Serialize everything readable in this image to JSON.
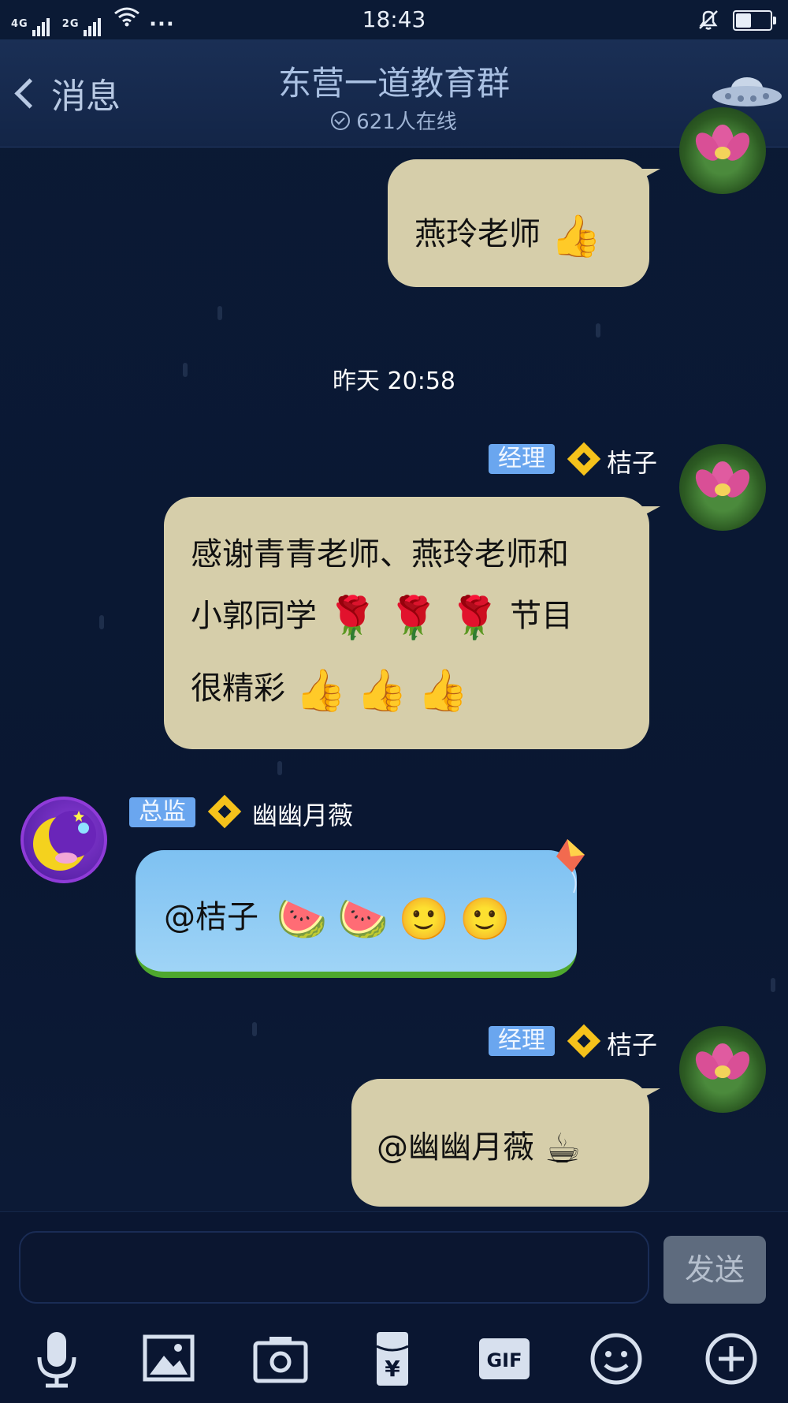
{
  "status_bar": {
    "network_1": "4G",
    "network_2": "2G",
    "time": "18:43",
    "battery_level": 0.45
  },
  "header": {
    "back_label": "消息",
    "title": "东营一道教育群",
    "online_count": "621人在线"
  },
  "messages": [
    {
      "side": "right",
      "text": "燕玲老师",
      "emojis": [
        "thumbs-up"
      ]
    },
    {
      "type": "timestamp",
      "text": "昨天 20:58"
    },
    {
      "side": "right",
      "role": "经理",
      "sender": "桔子",
      "lines": [
        "感谢青青老师、燕玲老师和",
        "小郭同学",
        "节目",
        "很精彩"
      ],
      "emojis": [
        "rose",
        "rose",
        "rose",
        "thumbs-up",
        "thumbs-up",
        "thumbs-up"
      ]
    },
    {
      "side": "left",
      "role": "总监",
      "sender": "幽幽月薇",
      "text": "@桔子",
      "emojis": [
        "watermelon",
        "watermelon",
        "smile",
        "smile"
      ]
    },
    {
      "side": "right",
      "role": "经理",
      "sender": "桔子",
      "text": "@幽幽月薇",
      "emojis": [
        "coffee"
      ]
    }
  ],
  "input": {
    "send_label": "发送"
  },
  "toolbar": [
    "microphone-icon",
    "image-icon",
    "camera-icon",
    "red-packet-icon",
    "gif-icon",
    "emoji-icon",
    "plus-icon"
  ],
  "toolbar_labels": {
    "gif": "GIF",
    "yuan": "¥"
  },
  "glyphs": {
    "thumbs": "👍",
    "rose": "🌹",
    "melon": "🍉",
    "smile": "🙂",
    "coffee": "☕"
  }
}
